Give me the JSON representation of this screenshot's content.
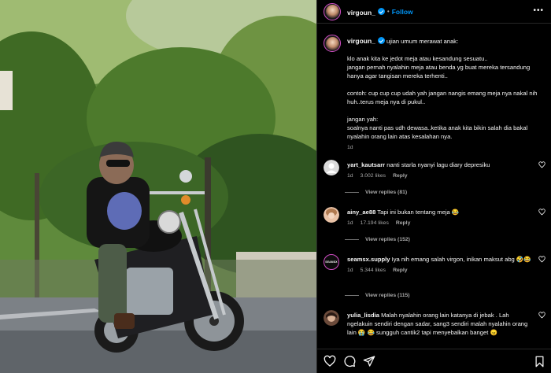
{
  "post": {
    "username": "virgoun_",
    "follow_label": "Follow",
    "more_label": "•••"
  },
  "caption": {
    "username": "virgoun_",
    "intro": "ujian umum merawat anak:",
    "text": "klo anak kita ke jedot meja atau kesandung sesuatu..\njangan pernah nyalahin meja atau benda yg buat mereka tersandung hanya agar tangisan mereka terhenti..\n\ncontoh: cup cup cup udah yah jangan nangis emang meja nya nakal nih huh..terus meja nya di pukul..\n\njangan yah:\nsoalnya nanti pas udh dewasa..ketika anak kita bikin salah dia bakal nyalahin orang lain atas kesalahan nya.",
    "time": "1d"
  },
  "comments": [
    {
      "username": "yart_kautsarr",
      "text": "nanti starla nyanyi lagu diary depresiku",
      "time": "1d",
      "likes": "3.002 likes",
      "reply_label": "Reply",
      "view_replies": "View replies (81)"
    },
    {
      "username": "ainy_ae88",
      "text": "Tapi ini bukan tentang meja 😂",
      "time": "1d",
      "likes": "17.194 likes",
      "reply_label": "Reply",
      "view_replies": "View replies (152)"
    },
    {
      "username": "seamsx.supply",
      "avatar_label": "SEAMSX",
      "text": "Iya nih emang salah virgon, inikan maksut abg 🤣😂",
      "time": "1d",
      "likes": "5.344 likes",
      "reply_label": "Reply",
      "view_replies": "View replies (115)"
    },
    {
      "username": "yulia_lisdia",
      "text": "Malah nyalahin orang lain katanya di jebak . Lah ngelakuin sendiri dengan sadar, sang3 sendiri malah nyalahin orang lain 😭 😂 sungguh cantik2 tapi menyebalkan banget 😠"
    }
  ],
  "icons": {
    "like": "heart-icon",
    "comment": "comment-icon",
    "share": "share-icon",
    "save": "bookmark-icon"
  },
  "colors": {
    "accent": "#0095f6",
    "background": "#000000",
    "muted": "#a8a8a8"
  }
}
